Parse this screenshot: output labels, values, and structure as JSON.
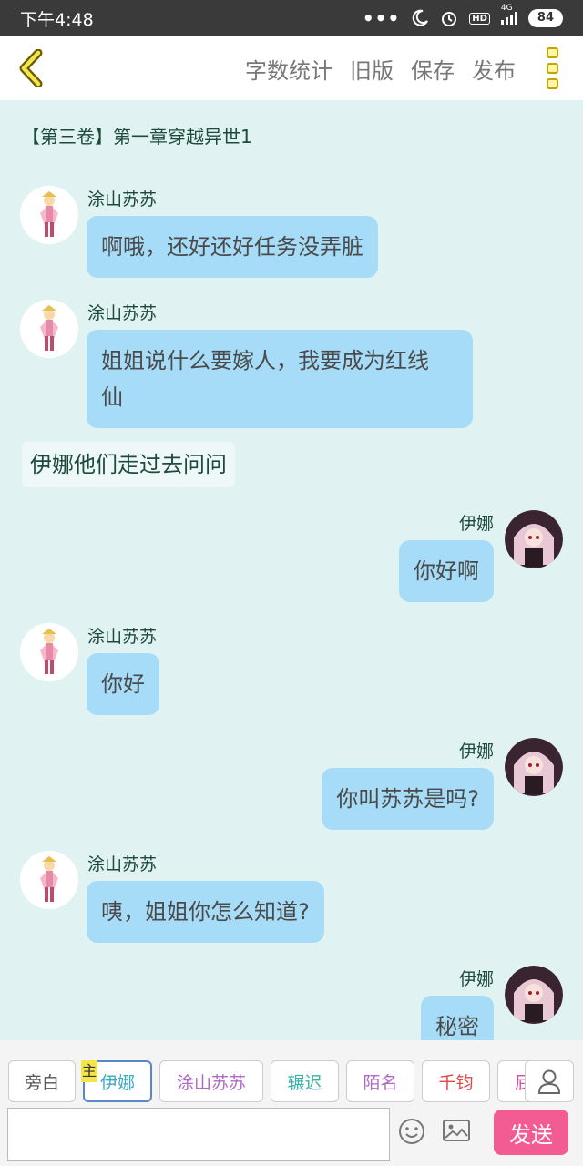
{
  "status_bar": {
    "time": "下午4:48",
    "dots": "•••",
    "network": "4G",
    "hd": "HD",
    "battery": "84"
  },
  "toolbar": {
    "word_count": "字数统计",
    "old_version": "旧版",
    "save": "保存",
    "publish": "发布"
  },
  "chapter_title": "【第三卷】第一章穿越异世1",
  "messages": [
    {
      "speaker": "涂山苏苏",
      "text": "啊哦，还好还好任务没弄脏"
    },
    {
      "speaker": "涂山苏苏",
      "line1": "姐姐说什么要嫁人，我要成为红线",
      "line2": "仙"
    },
    {
      "narration": "伊娜他们走过去问问"
    },
    {
      "speaker": "伊娜",
      "text": "你好啊"
    },
    {
      "speaker": "涂山苏苏",
      "text": "你好"
    },
    {
      "speaker": "伊娜",
      "text": "你叫苏苏是吗?"
    },
    {
      "speaker": "涂山苏苏",
      "text": "咦，姐姐你怎么知道?"
    },
    {
      "speaker": "伊娜",
      "text": "秘密"
    }
  ],
  "roles": [
    {
      "label": "旁白",
      "color": "#555555"
    },
    {
      "label": "伊娜",
      "color": "#3aa8c4"
    },
    {
      "label": "涂山苏苏",
      "color": "#b06ac6"
    },
    {
      "label": "辗迟",
      "color": "#3bb0a8"
    },
    {
      "label": "陌名",
      "color": "#b06ac6"
    },
    {
      "label": "千钧",
      "color": "#e04848"
    },
    {
      "label": "屁",
      "color": "#d84a9a"
    }
  ],
  "main_tag": "主",
  "input": {
    "placeholder": "",
    "value": ""
  },
  "send_label": "发送",
  "icons": {
    "back": "back-arrow-icon",
    "menu": "menu-icon",
    "emoji": "emoji-icon",
    "image": "image-icon",
    "user": "user-icon"
  }
}
